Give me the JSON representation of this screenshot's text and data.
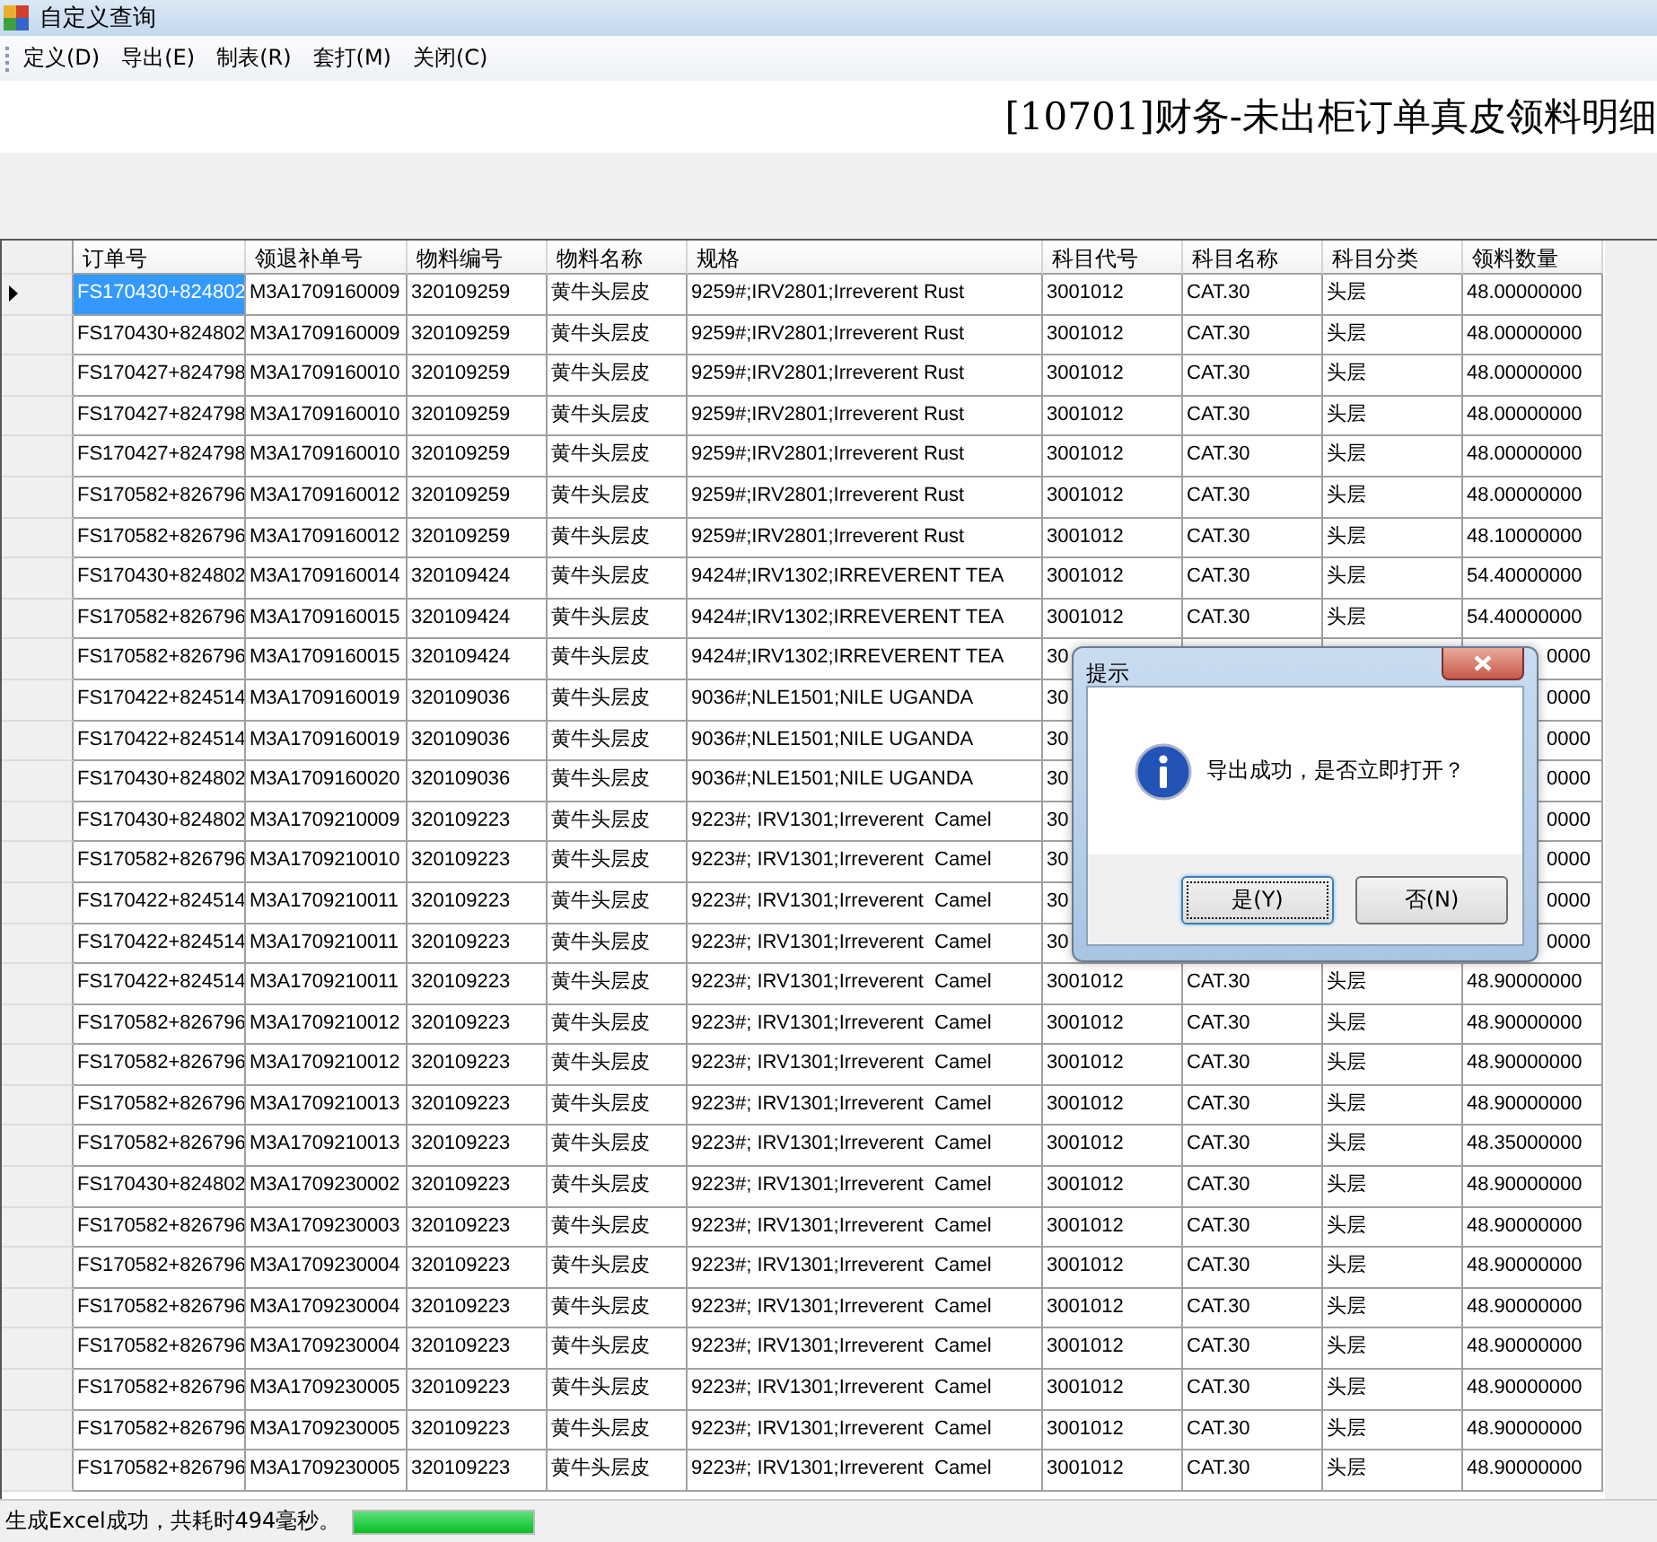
{
  "window": {
    "title": "自定义查询"
  },
  "menu": [
    "定义(D)",
    "导出(E)",
    "制表(R)",
    "套打(M)",
    "关闭(C)"
  ],
  "report_title": "[10701]财务-未出柜订单真皮领料明细",
  "table": {
    "columns": [
      "订单号",
      "领退补单号",
      "物料编号",
      "物料名称",
      "规格",
      "科目代号",
      "科目名称",
      "科目分类",
      "领料数量"
    ],
    "rows": [
      {
        "selected": true,
        "cells": [
          "FS170430+824802",
          "M3A1709160009",
          "320109259",
          "黄牛头层皮",
          "9259#;IRV2801;Irreverent Rust",
          "3001012",
          "CAT.30",
          "头层",
          "48.00000000"
        ]
      },
      {
        "selected": false,
        "cells": [
          "FS170430+824802",
          "M3A1709160009",
          "320109259",
          "黄牛头层皮",
          "9259#;IRV2801;Irreverent Rust",
          "3001012",
          "CAT.30",
          "头层",
          "48.00000000"
        ]
      },
      {
        "selected": false,
        "cells": [
          "FS170427+824798",
          "M3A1709160010",
          "320109259",
          "黄牛头层皮",
          "9259#;IRV2801;Irreverent Rust",
          "3001012",
          "CAT.30",
          "头层",
          "48.00000000"
        ]
      },
      {
        "selected": false,
        "cells": [
          "FS170427+824798",
          "M3A1709160010",
          "320109259",
          "黄牛头层皮",
          "9259#;IRV2801;Irreverent Rust",
          "3001012",
          "CAT.30",
          "头层",
          "48.00000000"
        ]
      },
      {
        "selected": false,
        "cells": [
          "FS170427+824798",
          "M3A1709160010",
          "320109259",
          "黄牛头层皮",
          "9259#;IRV2801;Irreverent Rust",
          "3001012",
          "CAT.30",
          "头层",
          "48.00000000"
        ]
      },
      {
        "selected": false,
        "cells": [
          "FS170582+826796",
          "M3A1709160012",
          "320109259",
          "黄牛头层皮",
          "9259#;IRV2801;Irreverent Rust",
          "3001012",
          "CAT.30",
          "头层",
          "48.00000000"
        ]
      },
      {
        "selected": false,
        "cells": [
          "FS170582+826796",
          "M3A1709160012",
          "320109259",
          "黄牛头层皮",
          "9259#;IRV2801;Irreverent Rust",
          "3001012",
          "CAT.30",
          "头层",
          "48.10000000"
        ]
      },
      {
        "selected": false,
        "cells": [
          "FS170430+824802",
          "M3A1709160014",
          "320109424",
          "黄牛头层皮",
          "9424#;IRV1302;IRREVERENT TEA",
          "3001012",
          "CAT.30",
          "头层",
          "54.40000000"
        ]
      },
      {
        "selected": false,
        "cells": [
          "FS170582+826796",
          "M3A1709160015",
          "320109424",
          "黄牛头层皮",
          "9424#;IRV1302;IRREVERENT TEA",
          "3001012",
          "CAT.30",
          "头层",
          "54.40000000"
        ]
      },
      {
        "selected": false,
        "cells": [
          "FS170582+826796",
          "M3A1709160015",
          "320109424",
          "黄牛头层皮",
          "9424#;IRV1302;IRREVERENT TEA",
          "30"
        ],
        "tail": "0000"
      },
      {
        "selected": false,
        "cells": [
          "FS170422+824514",
          "M3A1709160019",
          "320109036",
          "黄牛头层皮",
          "9036#;NLE1501;NILE UGANDA",
          "30"
        ],
        "tail": "0000"
      },
      {
        "selected": false,
        "cells": [
          "FS170422+824514",
          "M3A1709160019",
          "320109036",
          "黄牛头层皮",
          "9036#;NLE1501;NILE UGANDA",
          "30"
        ],
        "tail": "0000"
      },
      {
        "selected": false,
        "cells": [
          "FS170430+824802",
          "M3A1709160020",
          "320109036",
          "黄牛头层皮",
          "9036#;NLE1501;NILE UGANDA",
          "30"
        ],
        "tail": "0000"
      },
      {
        "selected": false,
        "cells": [
          "FS170430+824802",
          "M3A1709210009",
          "320109223",
          "黄牛头层皮",
          "9223#; IRV1301;Irreverent  Camel",
          "30"
        ],
        "tail": "0000"
      },
      {
        "selected": false,
        "cells": [
          "FS170582+826796",
          "M3A1709210010",
          "320109223",
          "黄牛头层皮",
          "9223#; IRV1301;Irreverent  Camel",
          "30"
        ],
        "tail": "0000"
      },
      {
        "selected": false,
        "cells": [
          "FS170422+824514",
          "M3A1709210011",
          "320109223",
          "黄牛头层皮",
          "9223#; IRV1301;Irreverent  Camel",
          "30"
        ],
        "tail": "0000"
      },
      {
        "selected": false,
        "cells": [
          "FS170422+824514",
          "M3A1709210011",
          "320109223",
          "黄牛头层皮",
          "9223#; IRV1301;Irreverent  Camel",
          "30"
        ],
        "tail": "0000"
      },
      {
        "selected": false,
        "cells": [
          "FS170422+824514",
          "M3A1709210011",
          "320109223",
          "黄牛头层皮",
          "9223#; IRV1301;Irreverent  Camel",
          "3001012",
          "CAT.30",
          "头层",
          "48.90000000"
        ]
      },
      {
        "selected": false,
        "cells": [
          "FS170582+826796",
          "M3A1709210012",
          "320109223",
          "黄牛头层皮",
          "9223#; IRV1301;Irreverent  Camel",
          "3001012",
          "CAT.30",
          "头层",
          "48.90000000"
        ]
      },
      {
        "selected": false,
        "cells": [
          "FS170582+826796",
          "M3A1709210012",
          "320109223",
          "黄牛头层皮",
          "9223#; IRV1301;Irreverent  Camel",
          "3001012",
          "CAT.30",
          "头层",
          "48.90000000"
        ]
      },
      {
        "selected": false,
        "cells": [
          "FS170582+826796",
          "M3A1709210013",
          "320109223",
          "黄牛头层皮",
          "9223#; IRV1301;Irreverent  Camel",
          "3001012",
          "CAT.30",
          "头层",
          "48.90000000"
        ]
      },
      {
        "selected": false,
        "cells": [
          "FS170582+826796",
          "M3A1709210013",
          "320109223",
          "黄牛头层皮",
          "9223#; IRV1301;Irreverent  Camel",
          "3001012",
          "CAT.30",
          "头层",
          "48.35000000"
        ]
      },
      {
        "selected": false,
        "cells": [
          "FS170430+824802",
          "M3A1709230002",
          "320109223",
          "黄牛头层皮",
          "9223#; IRV1301;Irreverent  Camel",
          "3001012",
          "CAT.30",
          "头层",
          "48.90000000"
        ]
      },
      {
        "selected": false,
        "cells": [
          "FS170582+826796",
          "M3A1709230003",
          "320109223",
          "黄牛头层皮",
          "9223#; IRV1301;Irreverent  Camel",
          "3001012",
          "CAT.30",
          "头层",
          "48.90000000"
        ]
      },
      {
        "selected": false,
        "cells": [
          "FS170582+826796",
          "M3A1709230004",
          "320109223",
          "黄牛头层皮",
          "9223#; IRV1301;Irreverent  Camel",
          "3001012",
          "CAT.30",
          "头层",
          "48.90000000"
        ]
      },
      {
        "selected": false,
        "cells": [
          "FS170582+826796",
          "M3A1709230004",
          "320109223",
          "黄牛头层皮",
          "9223#; IRV1301;Irreverent  Camel",
          "3001012",
          "CAT.30",
          "头层",
          "48.90000000"
        ]
      },
      {
        "selected": false,
        "cells": [
          "FS170582+826796",
          "M3A1709230004",
          "320109223",
          "黄牛头层皮",
          "9223#; IRV1301;Irreverent  Camel",
          "3001012",
          "CAT.30",
          "头层",
          "48.90000000"
        ]
      },
      {
        "selected": false,
        "cells": [
          "FS170582+826796",
          "M3A1709230005",
          "320109223",
          "黄牛头层皮",
          "9223#; IRV1301;Irreverent  Camel",
          "3001012",
          "CAT.30",
          "头层",
          "48.90000000"
        ]
      },
      {
        "selected": false,
        "cells": [
          "FS170582+826796",
          "M3A1709230005",
          "320109223",
          "黄牛头层皮",
          "9223#; IRV1301;Irreverent  Camel",
          "3001012",
          "CAT.30",
          "头层",
          "48.90000000"
        ]
      },
      {
        "selected": false,
        "cells": [
          "FS170582+826796",
          "M3A1709230005",
          "320109223",
          "黄牛头层皮",
          "9223#; IRV1301;Irreverent  Camel",
          "3001012",
          "CAT.30",
          "头层",
          "48.90000000"
        ]
      }
    ]
  },
  "dialog": {
    "title": "提示",
    "message": "导出成功，是否立即打开？",
    "buttons": [
      {
        "label": "是(Y)",
        "selected": true
      },
      {
        "label": "否(N)",
        "selected": false
      }
    ]
  },
  "status_bar": {
    "text": "生成Excel成功，共耗时494毫秒。",
    "progress": {
      "level": 1
    }
  }
}
